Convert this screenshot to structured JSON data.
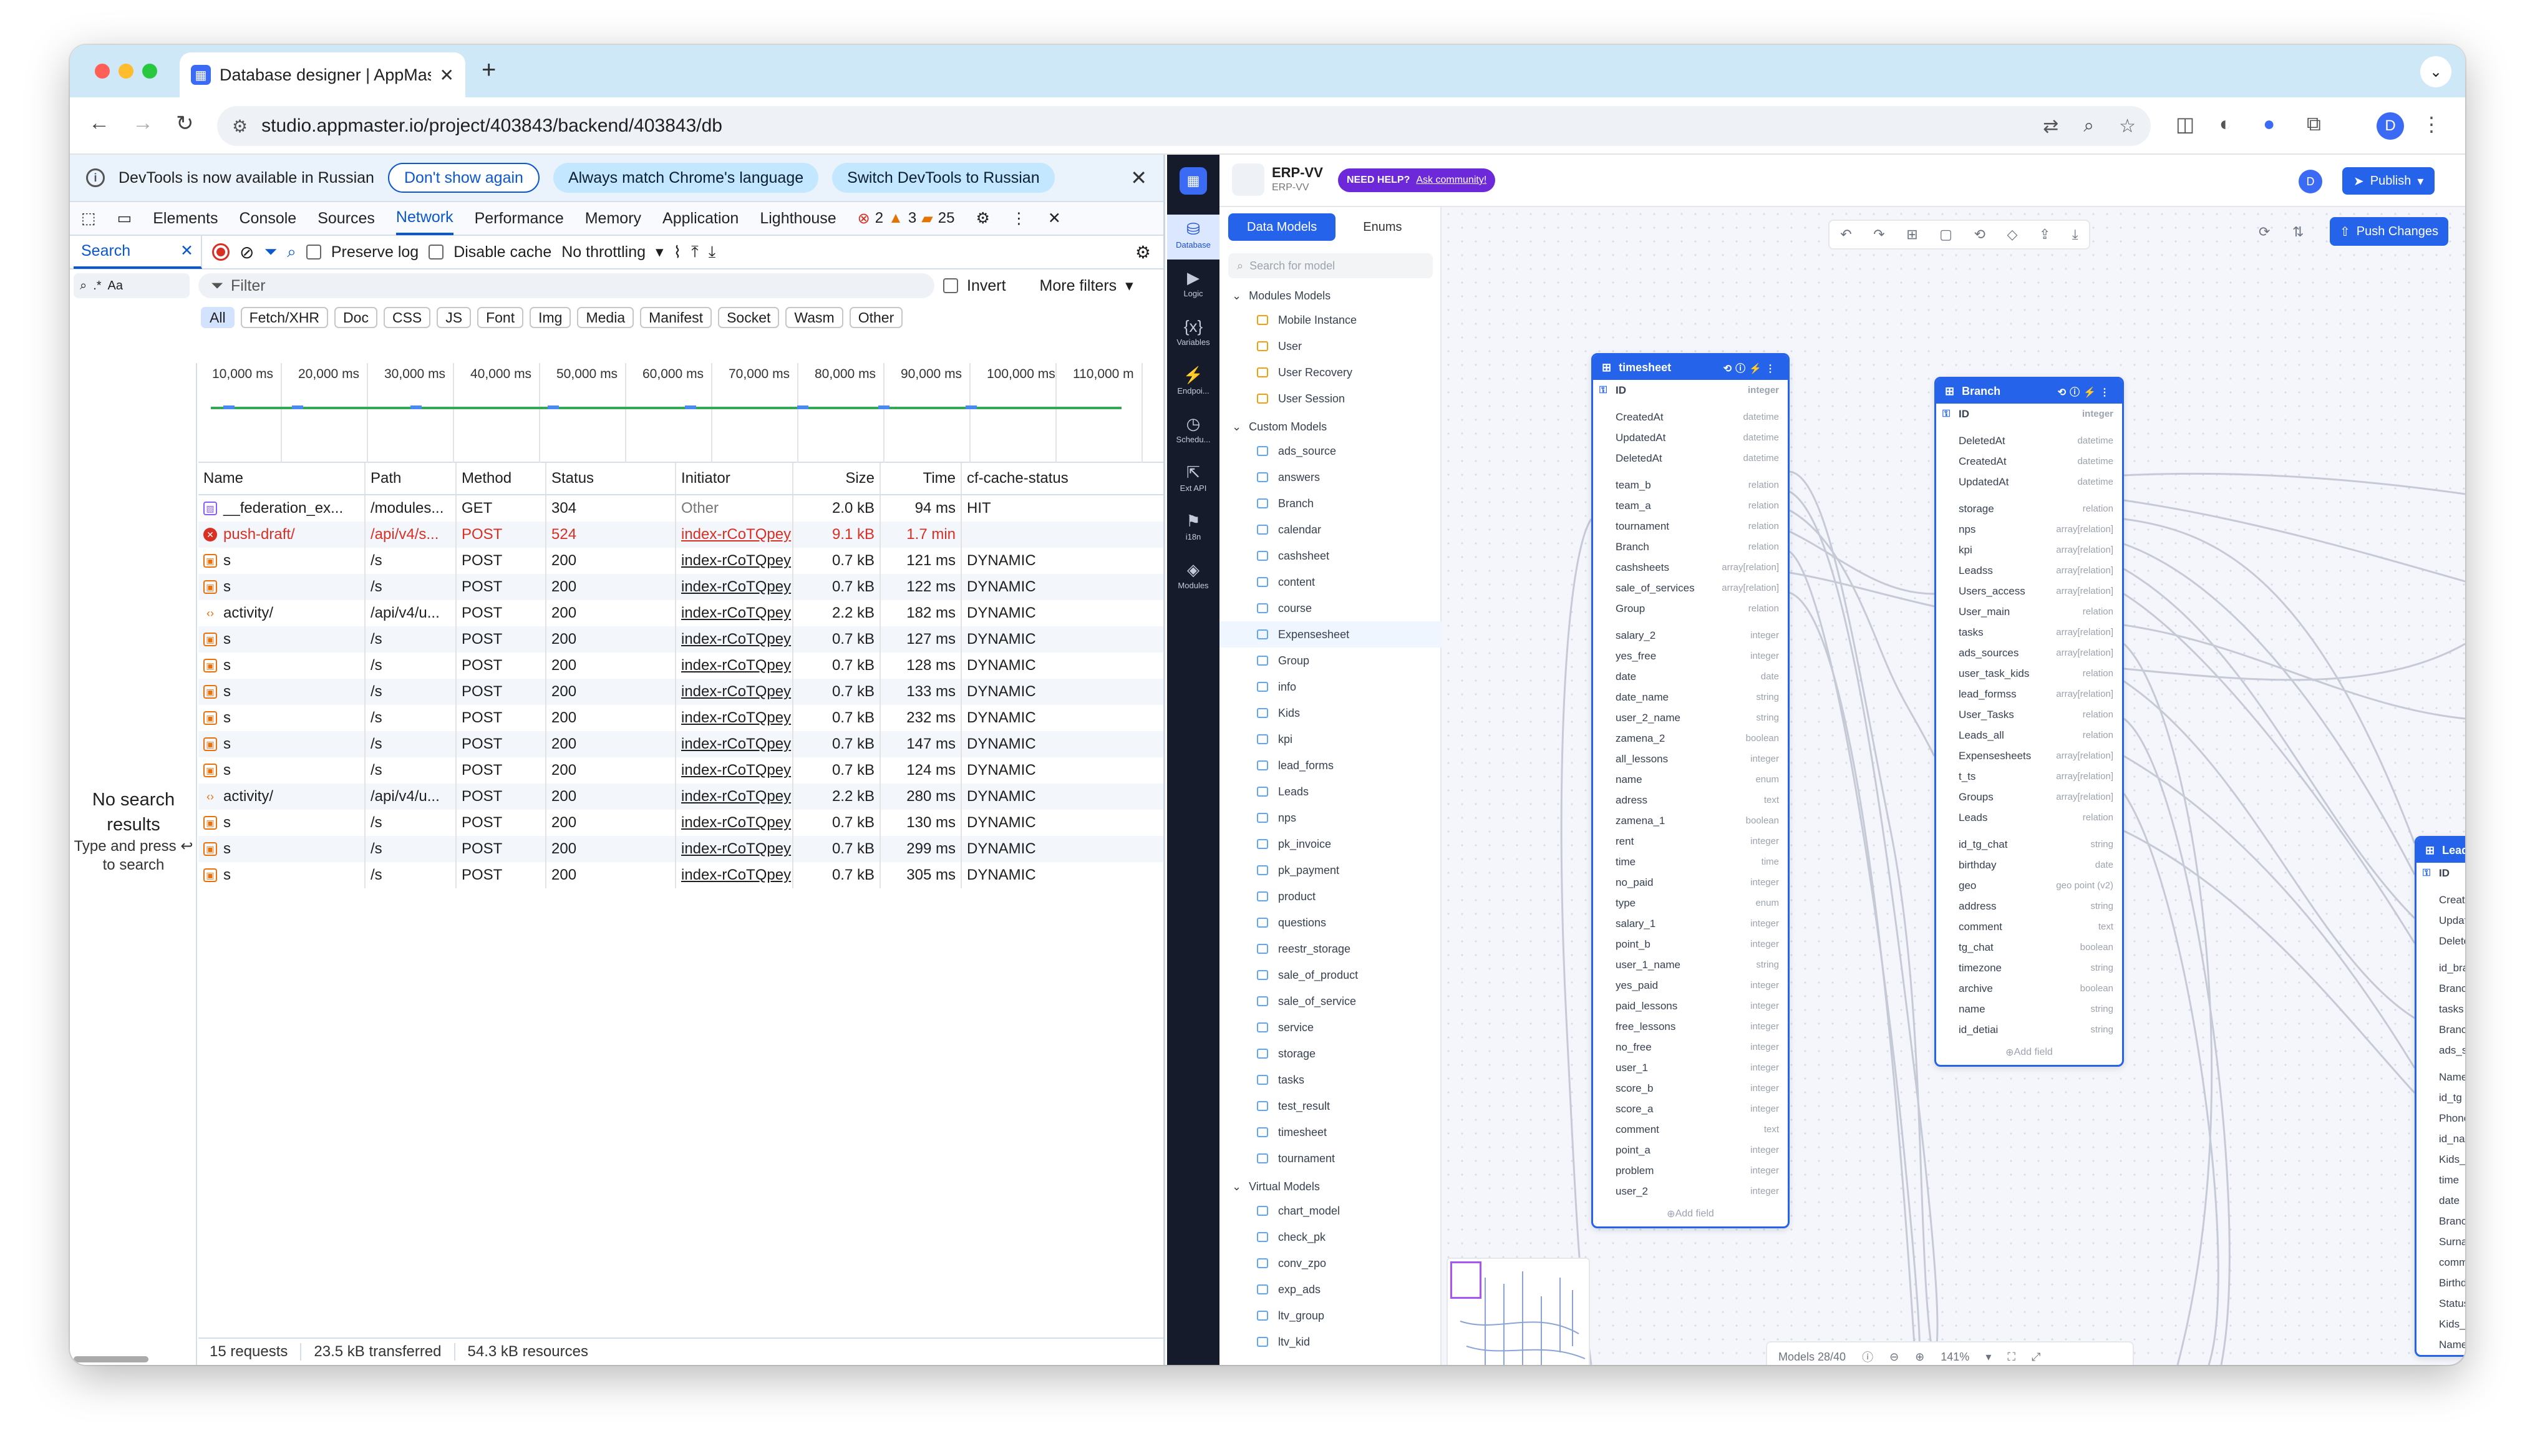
{
  "browser": {
    "tab_title": "Database designer | AppMaster",
    "url": "studio.appmaster.io/project/403843/backend/403843/db",
    "profile_initial": "D"
  },
  "devtools": {
    "banner": {
      "text": "DevTools is now available in Russian",
      "btn_dont": "Don't show again",
      "btn_match": "Always match Chrome's language",
      "btn_switch": "Switch DevTools to Russian"
    },
    "tabs": [
      "Elements",
      "Console",
      "Sources",
      "Network",
      "Performance",
      "Memory",
      "Application",
      "Lighthouse"
    ],
    "badges": {
      "errors": "2",
      "warnings": "3",
      "issues": "25"
    },
    "search_tab": "Search",
    "toolbar": {
      "preserve_log": "Preserve log",
      "disable_cache": "Disable cache",
      "throttling": "No throttling"
    },
    "search_box": {
      "case": "Aa"
    },
    "filter": {
      "placeholder": "Filter",
      "invert": "Invert",
      "more": "More filters"
    },
    "types": [
      "All",
      "Fetch/XHR",
      "Doc",
      "CSS",
      "JS",
      "Font",
      "Img",
      "Media",
      "Manifest",
      "Socket",
      "Wasm",
      "Other"
    ],
    "ticks": [
      "10,000 ms",
      "20,000 ms",
      "30,000 ms",
      "40,000 ms",
      "50,000 ms",
      "60,000 ms",
      "70,000 ms",
      "80,000 ms",
      "90,000 ms",
      "100,000 ms",
      "110,000 m"
    ],
    "no_results": {
      "title": "No search results",
      "sub": "Type and press ↩ to search"
    },
    "columns": [
      "Name",
      "Path",
      "Method",
      "Status",
      "Initiator",
      "Size",
      "Time",
      "cf-cache-status"
    ],
    "rows": [
      {
        "icon": "doc",
        "name": "__federation_ex...",
        "path": "/modules...",
        "method": "GET",
        "status": "304",
        "initiator": "Other",
        "size": "2.0 kB",
        "time": "94 ms",
        "cache": "HIT"
      },
      {
        "icon": "x",
        "name": "push-draft/",
        "path": "/api/v4/s...",
        "method": "POST",
        "status": "524",
        "initiator": "index-rCoTQpey",
        "size": "9.1 kB",
        "time": "1.7 min",
        "cache": "",
        "err": true
      },
      {
        "icon": "f",
        "name": "s",
        "path": "/s",
        "method": "POST",
        "status": "200",
        "initiator": "index-rCoTQpey",
        "size": "0.7 kB",
        "time": "121 ms",
        "cache": "DYNAMIC"
      },
      {
        "icon": "f",
        "name": "s",
        "path": "/s",
        "method": "POST",
        "status": "200",
        "initiator": "index-rCoTQpey",
        "size": "0.7 kB",
        "time": "122 ms",
        "cache": "DYNAMIC"
      },
      {
        "icon": "a",
        "name": "activity/",
        "path": "/api/v4/u...",
        "method": "POST",
        "status": "200",
        "initiator": "index-rCoTQpey",
        "size": "2.2 kB",
        "time": "182 ms",
        "cache": "DYNAMIC"
      },
      {
        "icon": "f",
        "name": "s",
        "path": "/s",
        "method": "POST",
        "status": "200",
        "initiator": "index-rCoTQpey",
        "size": "0.7 kB",
        "time": "127 ms",
        "cache": "DYNAMIC"
      },
      {
        "icon": "f",
        "name": "s",
        "path": "/s",
        "method": "POST",
        "status": "200",
        "initiator": "index-rCoTQpey",
        "size": "0.7 kB",
        "time": "128 ms",
        "cache": "DYNAMIC"
      },
      {
        "icon": "f",
        "name": "s",
        "path": "/s",
        "method": "POST",
        "status": "200",
        "initiator": "index-rCoTQpey",
        "size": "0.7 kB",
        "time": "133 ms",
        "cache": "DYNAMIC"
      },
      {
        "icon": "f",
        "name": "s",
        "path": "/s",
        "method": "POST",
        "status": "200",
        "initiator": "index-rCoTQpey",
        "size": "0.7 kB",
        "time": "232 ms",
        "cache": "DYNAMIC"
      },
      {
        "icon": "f",
        "name": "s",
        "path": "/s",
        "method": "POST",
        "status": "200",
        "initiator": "index-rCoTQpey",
        "size": "0.7 kB",
        "time": "147 ms",
        "cache": "DYNAMIC"
      },
      {
        "icon": "f",
        "name": "s",
        "path": "/s",
        "method": "POST",
        "status": "200",
        "initiator": "index-rCoTQpey",
        "size": "0.7 kB",
        "time": "124 ms",
        "cache": "DYNAMIC"
      },
      {
        "icon": "a",
        "name": "activity/",
        "path": "/api/v4/u...",
        "method": "POST",
        "status": "200",
        "initiator": "index-rCoTQpey",
        "size": "2.2 kB",
        "time": "280 ms",
        "cache": "DYNAMIC"
      },
      {
        "icon": "f",
        "name": "s",
        "path": "/s",
        "method": "POST",
        "status": "200",
        "initiator": "index-rCoTQpey",
        "size": "0.7 kB",
        "time": "130 ms",
        "cache": "DYNAMIC"
      },
      {
        "icon": "f",
        "name": "s",
        "path": "/s",
        "method": "POST",
        "status": "200",
        "initiator": "index-rCoTQpey",
        "size": "0.7 kB",
        "time": "299 ms",
        "cache": "DYNAMIC"
      },
      {
        "icon": "f",
        "name": "s",
        "path": "/s",
        "method": "POST",
        "status": "200",
        "initiator": "index-rCoTQpey",
        "size": "0.7 kB",
        "time": "305 ms",
        "cache": "DYNAMIC"
      }
    ],
    "status": {
      "requests": "15 requests",
      "transferred": "23.5 kB transferred",
      "resources": "54.3 kB resources"
    }
  },
  "appmaster": {
    "project_name": "ERP-VV",
    "project_sub": "ERP-VV",
    "help": {
      "label": "NEED HELP?",
      "link": "Ask community!"
    },
    "avatar": "D",
    "publish": "Publish",
    "push_changes": "Push Changes",
    "rail": [
      "Database",
      "Logic",
      "Variables",
      "Endpoi...",
      "Schedu...",
      "Ext API",
      "i18n",
      "Modules"
    ],
    "side_tabs": [
      "Data Models",
      "Enums"
    ],
    "search_placeholder": "Search for model",
    "groups": [
      {
        "title": "Modules Models",
        "items": [
          "Mobile Instance",
          "User",
          "User Recovery",
          "User Session"
        ],
        "kind": "o"
      },
      {
        "title": "Custom Models",
        "items": [
          "ads_source",
          "answers",
          "Branch",
          "calendar",
          "cashsheet",
          "content",
          "course",
          "Expensesheet",
          "Group",
          "info",
          "Kids",
          "kpi",
          "lead_forms",
          "Leads",
          "nps",
          "pk_invoice",
          "pk_payment",
          "product",
          "questions",
          "reestr_storage",
          "sale_of_product",
          "sale_of_service",
          "service",
          "storage",
          "tasks",
          "test_result",
          "timesheet",
          "tournament"
        ],
        "kind": "b"
      },
      {
        "title": "Virtual Models",
        "items": [
          "chart_model",
          "check_pk",
          "conv_zpo",
          "exp_ads",
          "ltv_group",
          "ltv_kid"
        ],
        "kind": "b"
      }
    ],
    "selected_model": "Expensesheet",
    "timesheet": {
      "title": "timesheet",
      "add": "Add field",
      "fields": [
        [
          "ID",
          "integer"
        ],
        [
          "CreatedAt",
          "datetime"
        ],
        [
          "UpdatedAt",
          "datetime"
        ],
        [
          "DeletedAt",
          "datetime"
        ],
        [
          "team_b",
          "relation"
        ],
        [
          "team_a",
          "relation"
        ],
        [
          "tournament",
          "relation"
        ],
        [
          "Branch",
          "relation"
        ],
        [
          "cashsheets",
          "array[relation]"
        ],
        [
          "sale_of_services",
          "array[relation]"
        ],
        [
          "Group",
          "relation"
        ],
        [
          "salary_2",
          "integer"
        ],
        [
          "yes_free",
          "integer"
        ],
        [
          "date",
          "date"
        ],
        [
          "date_name",
          "string"
        ],
        [
          "user_2_name",
          "string"
        ],
        [
          "zamena_2",
          "boolean"
        ],
        [
          "all_lessons",
          "integer"
        ],
        [
          "name",
          "enum"
        ],
        [
          "adress",
          "text"
        ],
        [
          "zamena_1",
          "boolean"
        ],
        [
          "rent",
          "integer"
        ],
        [
          "time",
          "time"
        ],
        [
          "no_paid",
          "integer"
        ],
        [
          "type",
          "enum"
        ],
        [
          "salary_1",
          "integer"
        ],
        [
          "point_b",
          "integer"
        ],
        [
          "user_1_name",
          "string"
        ],
        [
          "yes_paid",
          "integer"
        ],
        [
          "paid_lessons",
          "integer"
        ],
        [
          "free_lessons",
          "integer"
        ],
        [
          "no_free",
          "integer"
        ],
        [
          "user_1",
          "integer"
        ],
        [
          "score_b",
          "integer"
        ],
        [
          "score_a",
          "integer"
        ],
        [
          "comment",
          "text"
        ],
        [
          "point_a",
          "integer"
        ],
        [
          "problem",
          "integer"
        ],
        [
          "user_2",
          "integer"
        ]
      ]
    },
    "branch": {
      "title": "Branch",
      "add": "Add field",
      "fields": [
        [
          "ID",
          "integer"
        ],
        [
          "DeletedAt",
          "datetime"
        ],
        [
          "CreatedAt",
          "datetime"
        ],
        [
          "UpdatedAt",
          "datetime"
        ],
        [
          "storage",
          "relation"
        ],
        [
          "nps",
          "array[relation]"
        ],
        [
          "kpi",
          "array[relation]"
        ],
        [
          "Leadss",
          "array[relation]"
        ],
        [
          "Users_access",
          "array[relation]"
        ],
        [
          "User_main",
          "relation"
        ],
        [
          "tasks",
          "array[relation]"
        ],
        [
          "ads_sources",
          "array[relation]"
        ],
        [
          "user_task_kids",
          "relation"
        ],
        [
          "lead_formss",
          "array[relation]"
        ],
        [
          "User_Tasks",
          "relation"
        ],
        [
          "Leads_all",
          "relation"
        ],
        [
          "Expensesheets",
          "array[relation]"
        ],
        [
          "t_ts",
          "array[relation]"
        ],
        [
          "Groups",
          "array[relation]"
        ],
        [
          "Leads",
          "relation"
        ],
        [
          "id_tg_chat",
          "string"
        ],
        [
          "birthday",
          "date"
        ],
        [
          "geo",
          "geo point (v2)"
        ],
        [
          "address",
          "string"
        ],
        [
          "comment",
          "text"
        ],
        [
          "tg_chat",
          "boolean"
        ],
        [
          "timezone",
          "string"
        ],
        [
          "archive",
          "boolean"
        ],
        [
          "name",
          "string"
        ],
        [
          "id_detiai",
          "string"
        ]
      ]
    },
    "leads": {
      "title": "Leads",
      "fields": [
        "ID",
        "CreatedAt",
        "UpdatedAt",
        "DeletedAt",
        "id_branch",
        "Branch_n",
        "tasks",
        "Branch_m",
        "ads_sour",
        "Name_pa",
        "id_tg",
        "Phone",
        "id_name",
        "Kids_ids",
        "time",
        "date",
        "Branch",
        "Surname",
        "comment",
        "Birthday",
        "Status_le",
        "Kids_stat",
        "Name_ki"
      ]
    },
    "models_count": "Models 28/40",
    "zoom": "141%"
  }
}
